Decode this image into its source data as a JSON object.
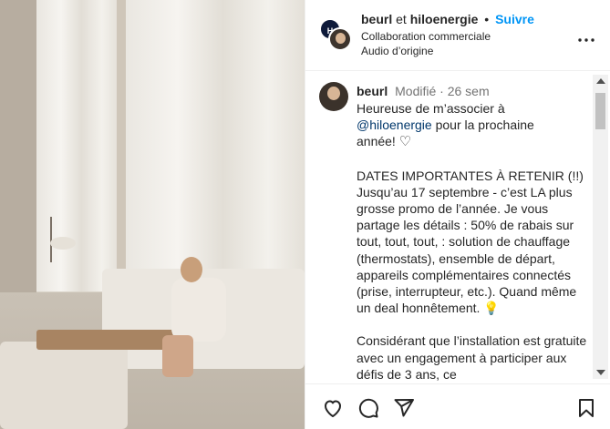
{
  "header": {
    "user_primary": "beurl",
    "connector": "et",
    "user_secondary": "hiloenergie",
    "separator": "•",
    "follow_label": "Suivre",
    "subtitle_1": "Collaboration commerciale",
    "subtitle_2": "Audio d’origine",
    "avatar_initials": "H"
  },
  "comment": {
    "username": "beurl",
    "edited": "Modifié",
    "separator": "·",
    "time": "26 sem",
    "line_1": "Heureuse de m’associer à",
    "mention": "@hiloenergie",
    "line_2": " pour la prochaine",
    "line_3": "année!",
    "heart": "♡",
    "para_2": "DATES IMPORTANTES À RETENIR (!!) Jusqu’au 17 septembre - c’est LA plus grosse promo de l’année. Je vous partage les détails : 50% de rabais sur tout, tout, tout, : solution de chauffage (thermostats), ensemble de départ, appareils complémentaires connectés (prise, interrupteur, etc.). Quand même un deal honnêtement.",
    "bulb": "💡",
    "para_3": "Considérant que l’installation est gratuite avec un engagement à participer aux défis de 3 ans, ce"
  },
  "icons": {
    "more": "more-icon",
    "like": "heart-icon",
    "comment": "comment-icon",
    "share": "send-icon",
    "save": "bookmark-icon"
  },
  "colors": {
    "follow": "#0095f6",
    "mention": "#00376b",
    "muted": "#737373"
  }
}
